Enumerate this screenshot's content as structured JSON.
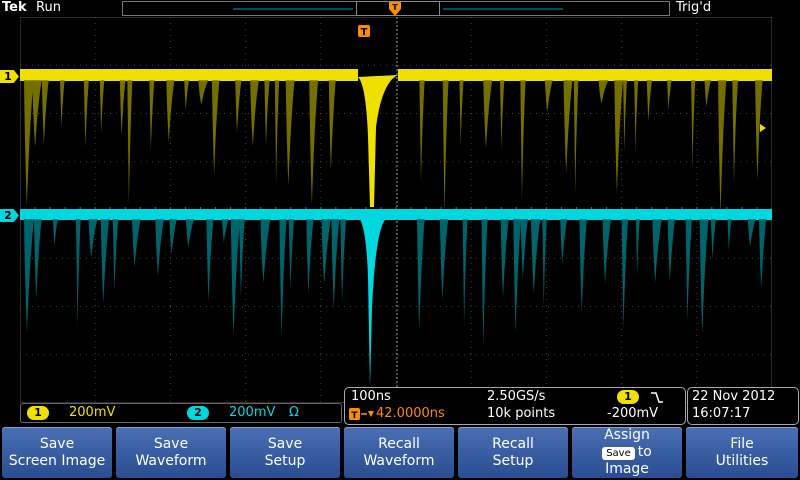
{
  "header": {
    "brand": "Tek",
    "run_state": "Run",
    "trigger_status": "Trig'd",
    "trigger_marker": "T"
  },
  "channels": [
    {
      "id": "1",
      "scale": "200mV",
      "suffix": "",
      "color": "#f0e000"
    },
    {
      "id": "2",
      "scale": "200mV",
      "suffix": "Ω",
      "color": "#00d8e0"
    }
  ],
  "timebase": {
    "scale": "100ns",
    "sample_rate": "2.50GS/s",
    "record_length": "10k points",
    "trigger_position": "42.0000ns",
    "trigger_source": "1",
    "trigger_slope_icon": "falling-edge-icon",
    "trigger_level": "-200mV"
  },
  "datetime": {
    "date": "22 Nov 2012",
    "time": "16:07:17"
  },
  "menu": {
    "buttons": [
      {
        "line1": "Save",
        "line2": "Screen Image"
      },
      {
        "line1": "Save",
        "line2": "Waveform"
      },
      {
        "line1": "Save",
        "line2": "Setup"
      },
      {
        "line1": "Recall",
        "line2": "Waveform"
      },
      {
        "line1": "Recall",
        "line2": "Setup"
      },
      {
        "line1": "Assign",
        "chip": "Save",
        "line2": "to",
        "line3": "Image"
      },
      {
        "line1": "File",
        "line2": "Utilities"
      }
    ]
  },
  "colors": {
    "ch1": "#f0e000",
    "ch2": "#00d8e0",
    "trigger": "#ff8c00",
    "menu": "#3a5fa8"
  }
}
